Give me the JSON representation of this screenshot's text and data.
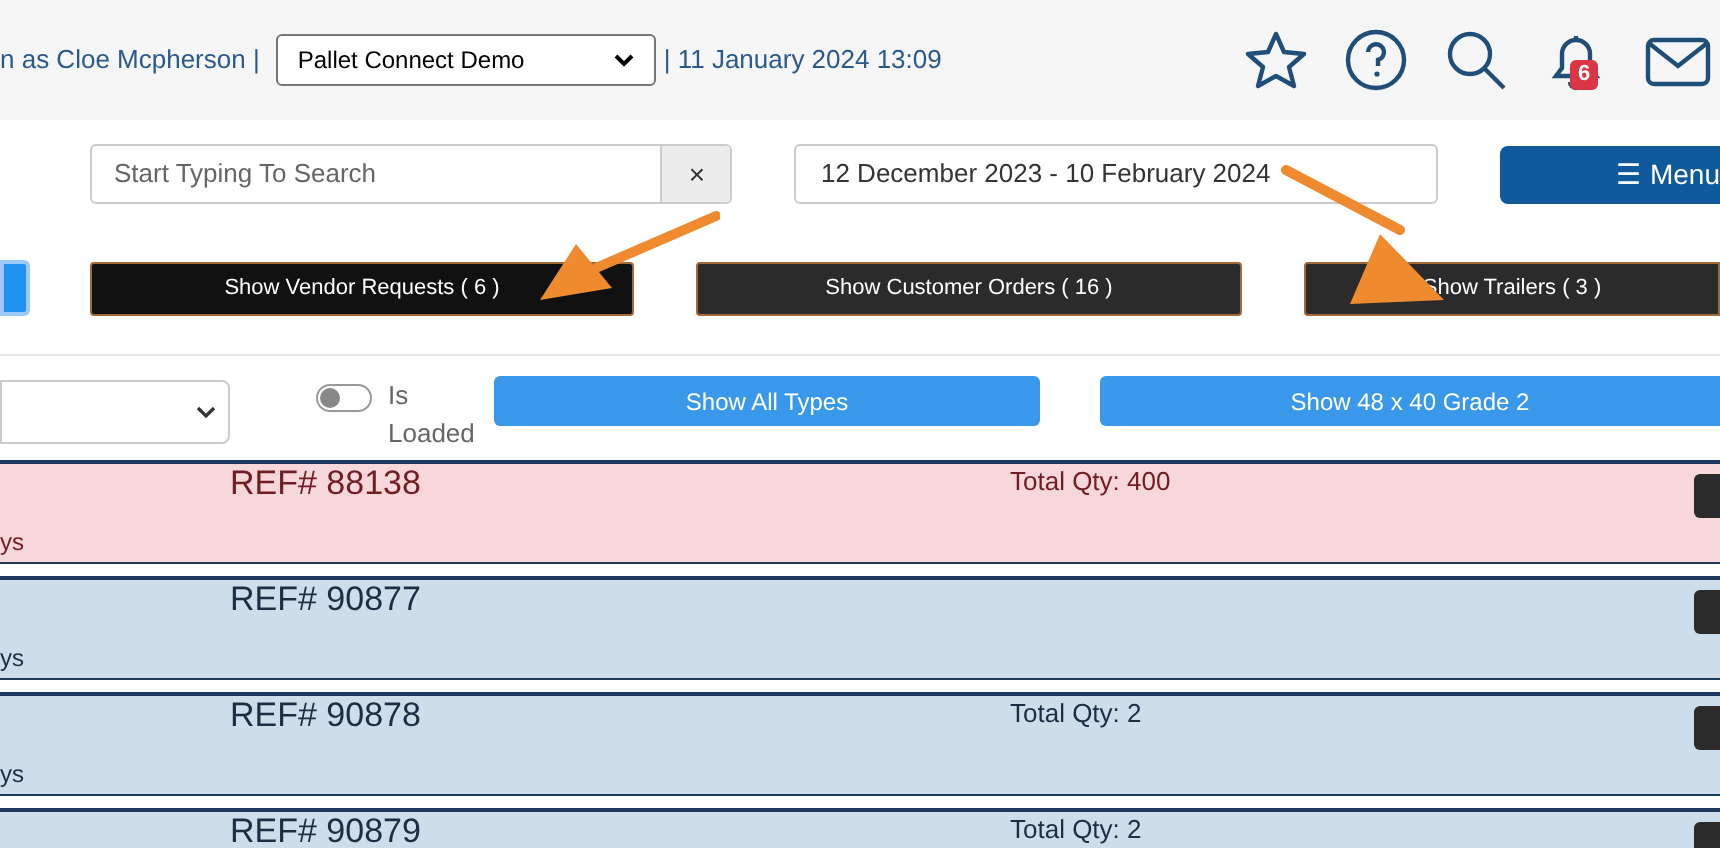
{
  "header": {
    "user_text": "n as Cloe Mcpherson |",
    "company_select": {
      "value": "Pallet Connect Demo"
    },
    "datetime": "| 11 January 2024 13:09",
    "notification_count": "6"
  },
  "search": {
    "placeholder": "Start Typing To Search",
    "clear": "×"
  },
  "date_range": {
    "value": "12 December 2023 - 10 February 2024"
  },
  "menu_button": "☰ Menu",
  "view_buttons": [
    {
      "label": "Show Vendor Requests ( 6 )",
      "selected": true
    },
    {
      "label": "Show Customer Orders ( 16 )",
      "selected": false
    },
    {
      "label": "Show Trailers ( 3 )",
      "selected": false
    }
  ],
  "is_loaded": {
    "label": "Is Loaded",
    "on": false
  },
  "type_buttons": [
    "Show All Types",
    "Show 48 x 40 Grade 2"
  ],
  "orders": [
    {
      "ref": "REF# 88138",
      "qty": "Total Qty: 400",
      "note": "ys",
      "kind": "alert"
    },
    {
      "ref": "REF# 90877",
      "note": "ys",
      "kind": "normal"
    },
    {
      "ref": "REF# 90878",
      "qty": "Total Qty: 2",
      "note": "ys",
      "kind": "normal"
    },
    {
      "ref": "REF# 90879",
      "qty": "Total Qty: 2",
      "kind": "normal"
    }
  ]
}
